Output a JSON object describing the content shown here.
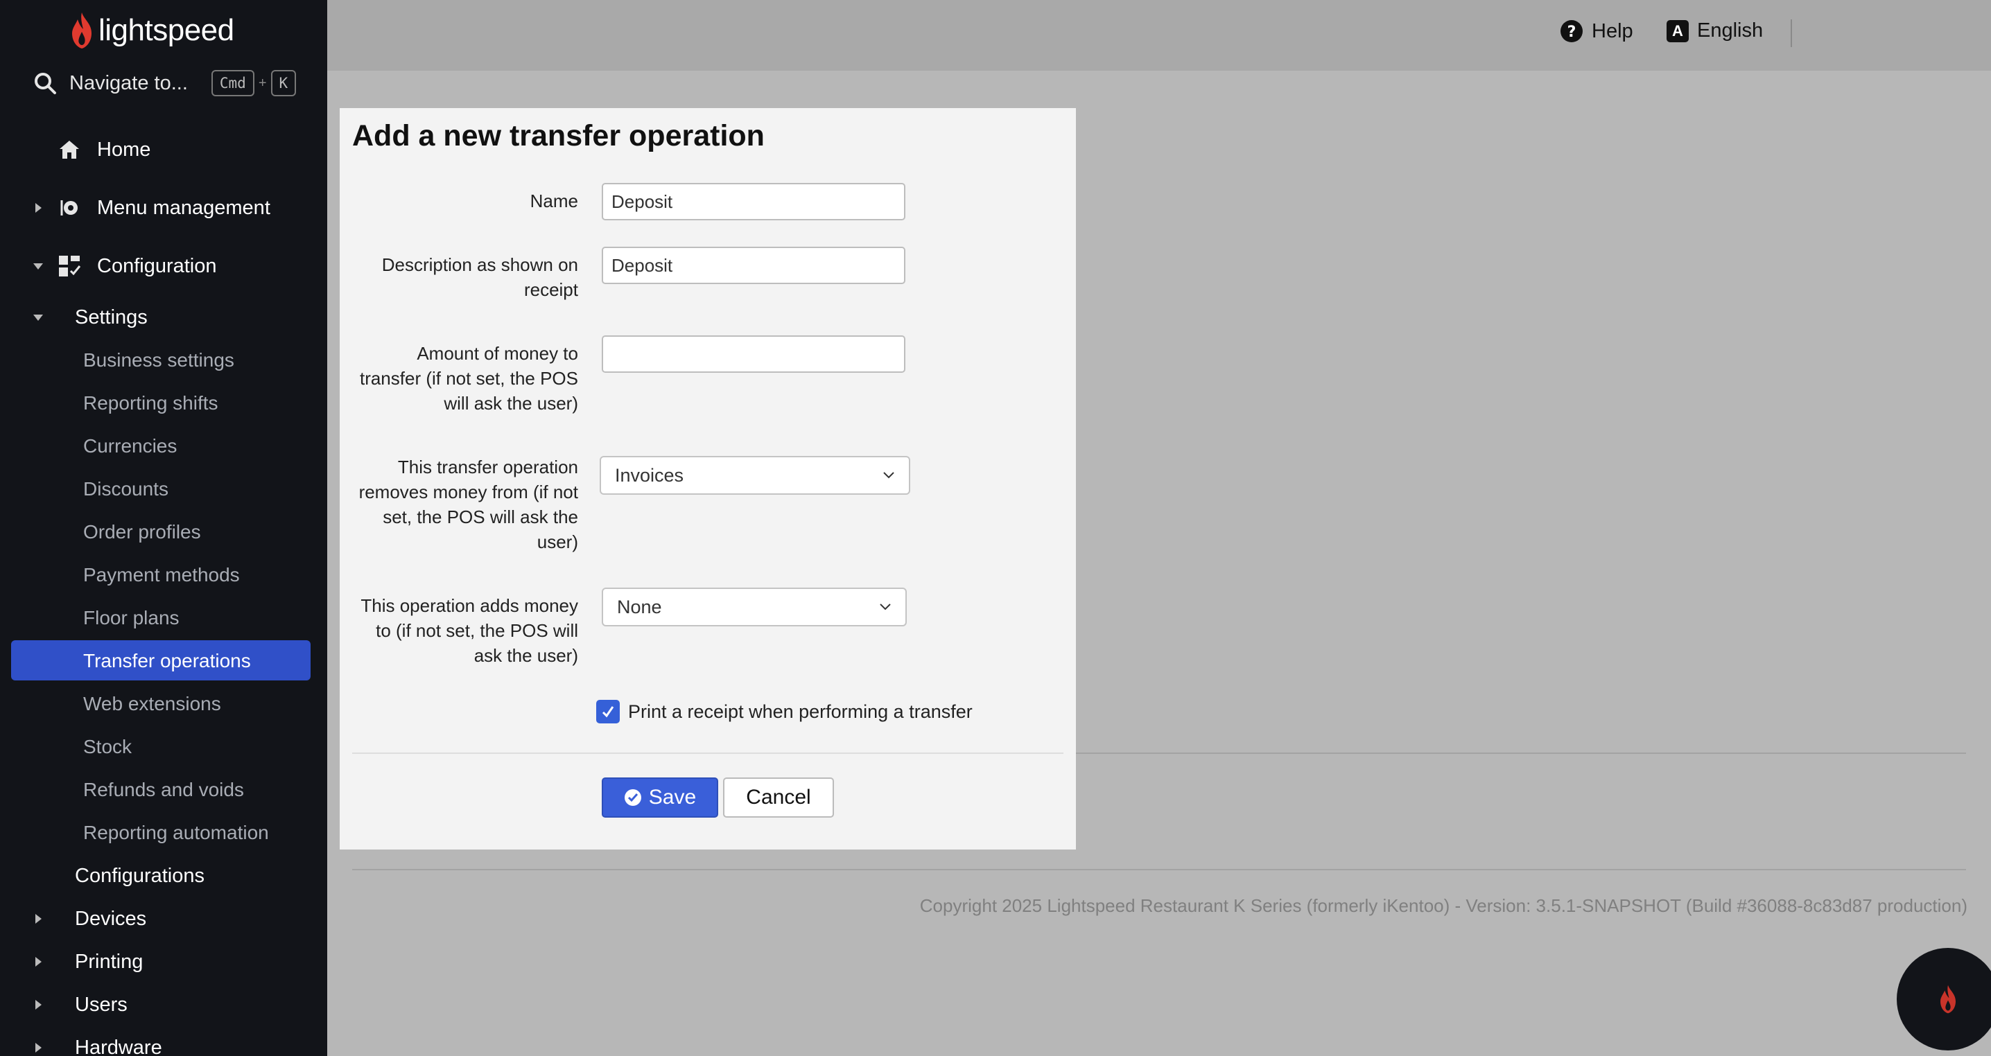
{
  "sidebar": {
    "logo_text": "lightspeed",
    "navigate": {
      "label": "Navigate to...",
      "kbd_cmd": "Cmd",
      "kbd_plus": "+",
      "kbd_key": "K"
    },
    "home": "Home",
    "menu_management": "Menu management",
    "configuration": "Configuration",
    "settings": "Settings",
    "settings_items": [
      "Business settings",
      "Reporting shifts",
      "Currencies",
      "Discounts",
      "Order profiles",
      "Payment methods",
      "Floor plans",
      "Transfer operations",
      "Web extensions",
      "Stock",
      "Refunds and voids",
      "Reporting automation"
    ],
    "active_item": "Transfer operations",
    "configurations": "Configurations",
    "devices": "Devices",
    "printing": "Printing",
    "users": "Users",
    "hardware": "Hardware"
  },
  "topbar": {
    "help": "Help",
    "language_icon_letter": "A",
    "language": "English"
  },
  "modal": {
    "title": "Add a new transfer operation",
    "name_label": "Name",
    "name_value": "Deposit",
    "description_label_l1": "Description as shown on",
    "description_label_l2": "receipt",
    "description_value": "Deposit",
    "amount_label_l1": "Amount of money to",
    "amount_label_l2": "transfer (if not set, the POS",
    "amount_label_l3": "will ask the user)",
    "amount_value": "",
    "removes_label_l1": "This transfer operation",
    "removes_label_l2": "removes money from (if not",
    "removes_label_l3": "set, the POS will ask the",
    "removes_label_l4": "user)",
    "removes_value": "Invoices",
    "adds_label_l1": "This operation adds money",
    "adds_label_l2": "to (if not set, the POS will",
    "adds_label_l3": "ask the user)",
    "adds_value": "None",
    "print_receipt_label": "Print a receipt when performing a transfer",
    "print_receipt_checked": true,
    "save_label": "Save",
    "cancel_label": "Cancel"
  },
  "footer": {
    "copyright": "Copyright 2025 Lightspeed Restaurant K Series (formerly iKentoo) - Version: 3.5.1-SNAPSHOT (Build #36088-8c83d87 production)"
  },
  "colors": {
    "sidebar_bg": "#121419",
    "active_item_bg": "#3050c8",
    "primary_button": "#3a5fd9",
    "brand_red": "#e03a2f",
    "overlay": "#b7b7b7"
  }
}
